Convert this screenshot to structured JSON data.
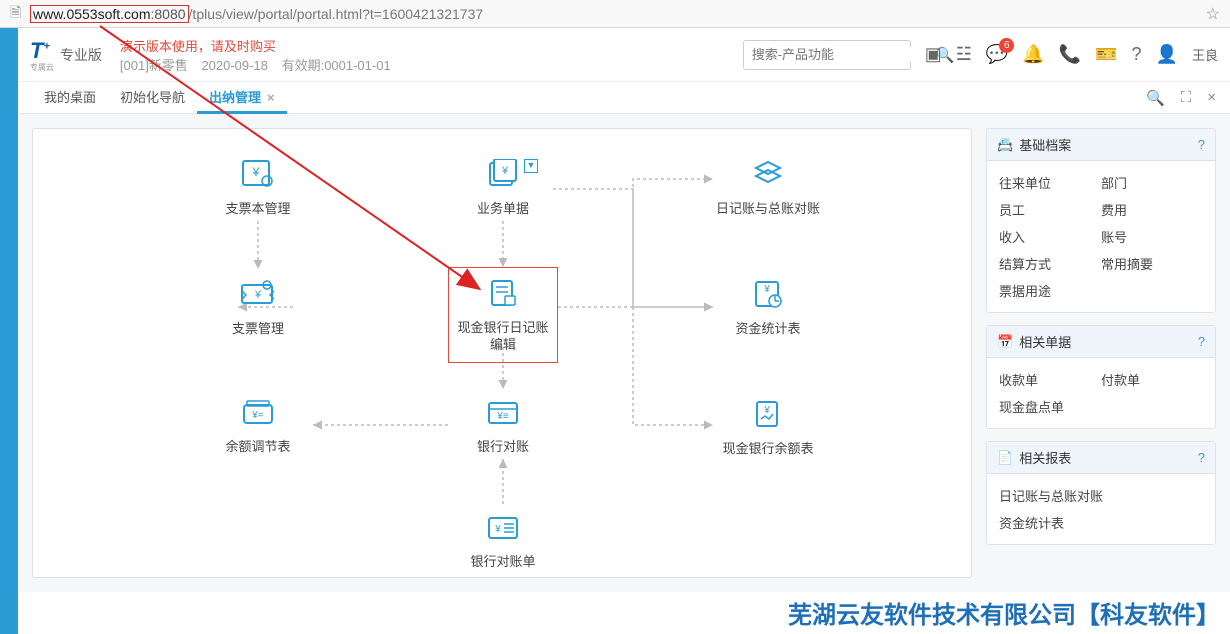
{
  "url": {
    "host": "www.0553soft.com",
    "port": ":8080",
    "path": "/tplus/view/portal/portal.html?t=1600421321737"
  },
  "header": {
    "logo_main": "T",
    "logo_plus": "+",
    "logo_sub": "专属云",
    "edition": "专业版",
    "demo_text": "演示版本使用，请及时购买",
    "org": "[001]新零售",
    "date": "2020-09-18",
    "expire_label": "有效期:",
    "expire": "0001-01-01",
    "search_placeholder": "搜索-产品功能",
    "badge_count": "6",
    "user": "王良"
  },
  "tabs": [
    {
      "label": "我的桌面",
      "active": false
    },
    {
      "label": "初始化导航",
      "active": false
    },
    {
      "label": "出纳管理",
      "active": true
    }
  ],
  "flow_nodes": {
    "n1": "支票本管理",
    "n2": "业务单据",
    "n3": "日记账与总账对账",
    "n4": "支票管理",
    "n5": "现金银行日记账编辑",
    "n6": "资金统计表",
    "n7": "余额调节表",
    "n8": "银行对账",
    "n9": "现金银行余额表",
    "n10": "银行对账单"
  },
  "panels": {
    "p1_title": "基础档案",
    "p1_items": [
      "往来单位",
      "部门",
      "员工",
      "费用",
      "收入",
      "账号",
      "结算方式",
      "常用摘要",
      "票据用途"
    ],
    "p2_title": "相关单据",
    "p2_items": [
      "收款单",
      "付款单",
      "现金盘点单"
    ],
    "p3_title": "相关报表",
    "p3_items": [
      "日记账与总账对账",
      "资金统计表"
    ]
  },
  "watermark": "芜湖云友软件技术有限公司【科友软件】"
}
